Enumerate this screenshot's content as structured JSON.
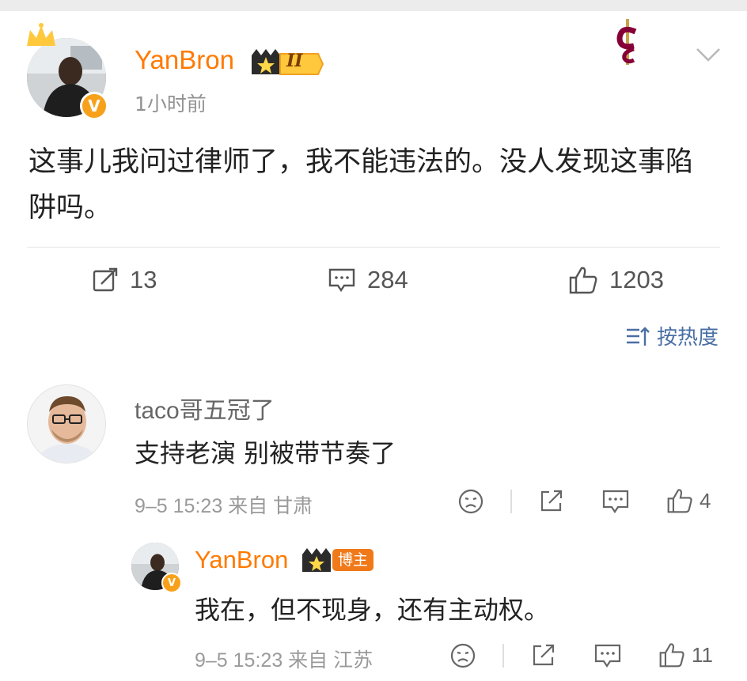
{
  "post": {
    "author": "YanBron",
    "level": "II",
    "time": "1小时前",
    "body": "这事儿我问过律师了，我不能违法的。没人发现这事陷阱吗。",
    "reposts": "13",
    "comments": "284",
    "likes": "1203"
  },
  "sort_label": "按热度",
  "comments": [
    {
      "author": "taco哥五冠了",
      "text": "支持老演 别被带节奏了",
      "meta": "9–5 15:23 来自 甘肃",
      "likes": "4"
    },
    {
      "author": "YanBron",
      "badge": "博主",
      "text": "我在，但不现身，还有主动权。",
      "meta": "9–5 15:23 来自 江苏",
      "likes": "11"
    }
  ],
  "colors": {
    "author_orange": "#ff7a00",
    "sort_blue": "#4a6fa5",
    "verified": "#f7a11b"
  }
}
